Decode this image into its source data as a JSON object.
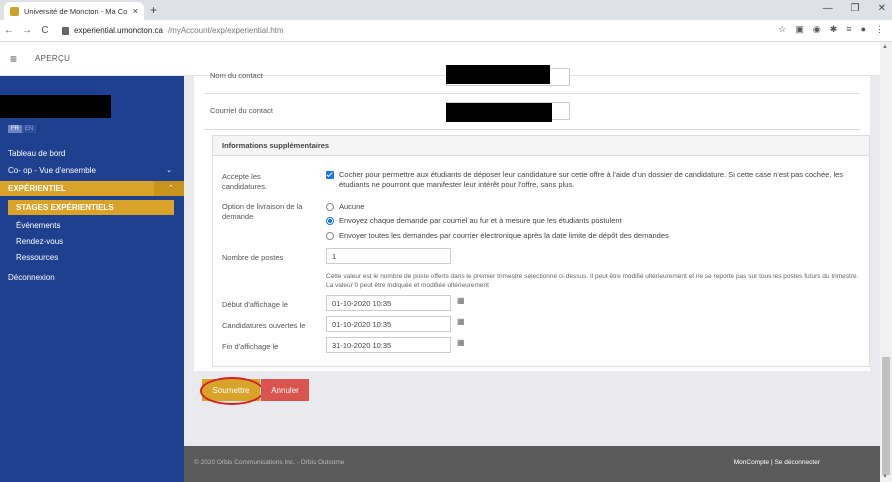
{
  "browser": {
    "tab_title": "Université de Moncton - Ma Co...",
    "tab_close": "×",
    "new_tab": "+",
    "window_controls": [
      "—",
      "❐",
      "✕"
    ],
    "url_domain": "experiential.umoncton.ca",
    "url_path": "/myAccount/exp/experiential.htm",
    "nav": [
      "←",
      "→",
      "C"
    ],
    "extensions": [
      "☆",
      "▣",
      "◉",
      "✱",
      "≡",
      "●",
      "⋮"
    ]
  },
  "header": {
    "menu_icon": "≡",
    "title": "APERÇU"
  },
  "sidebar": {
    "lang_fr": "FR",
    "lang_en": "EN",
    "items": [
      {
        "label": "Tableau de bord"
      },
      {
        "label": "Co- op - Vue d'ensemble",
        "chev": "⌄"
      },
      {
        "label": "EXPÉRIENTIEL",
        "chev": "⌃"
      },
      {
        "label": "STAGES EXPÉRIENTIELS"
      },
      {
        "label": "Événements"
      },
      {
        "label": "Rendez-vous"
      },
      {
        "label": "Ressources"
      },
      {
        "label": "Déconnexion"
      }
    ]
  },
  "form": {
    "contact_name_label": "Nom du contact",
    "contact_email_label": "Courriel du contact",
    "section_title": "Informations supplémentaires",
    "accept_label": "Accepte les candidatures.",
    "accept_text": "Cocher pour permettre aux étudiants de déposer leur candidature sur cette offre à l'aide d'un dossier de candidature. Si cette case n'est pas cochée, les étudiants ne pourront que manifester leur intérêt pour l'offre, sans plus.",
    "delivery_label": "Option de livraison de la demande",
    "delivery_options": [
      "Aucune",
      "Envoyez chaque demande par courriel au fur et à mesure que les étudiants postulent",
      "Envoyer toutes les demandes par courrier électronique après la date limite de dépôt des demandes"
    ],
    "positions_label": "Nombre de postes",
    "positions_value": "1",
    "positions_help": "Cette valeur est le nombre de poste offerts dans le premier trimestre sélectionné ci-dessus. Il peut être modifié ultérieurement et ne se reporte pas sur tous les postes futurs du trimestre. La valeur 0 peut être indiquée et modifiée ultérieurement",
    "start_label": "Début d'affichage le",
    "start_value": "01-10-2020 10:35",
    "open_label": "Candidatures ouvertes le",
    "open_value": "01-10-2020 10:35",
    "end_label": "Fin d'affichage le",
    "end_value": "31-10-2020 10:35",
    "calendar_icon": "▦",
    "submit": "Soumettre",
    "cancel": "Annuler"
  },
  "footer": {
    "copyright": "© 2020 Orbis Communications Inc. - Orbis Outcome",
    "links": "MonCompte  |  Se déconnecter"
  },
  "scrollbar": {
    "up": "▲",
    "down": "▼"
  }
}
